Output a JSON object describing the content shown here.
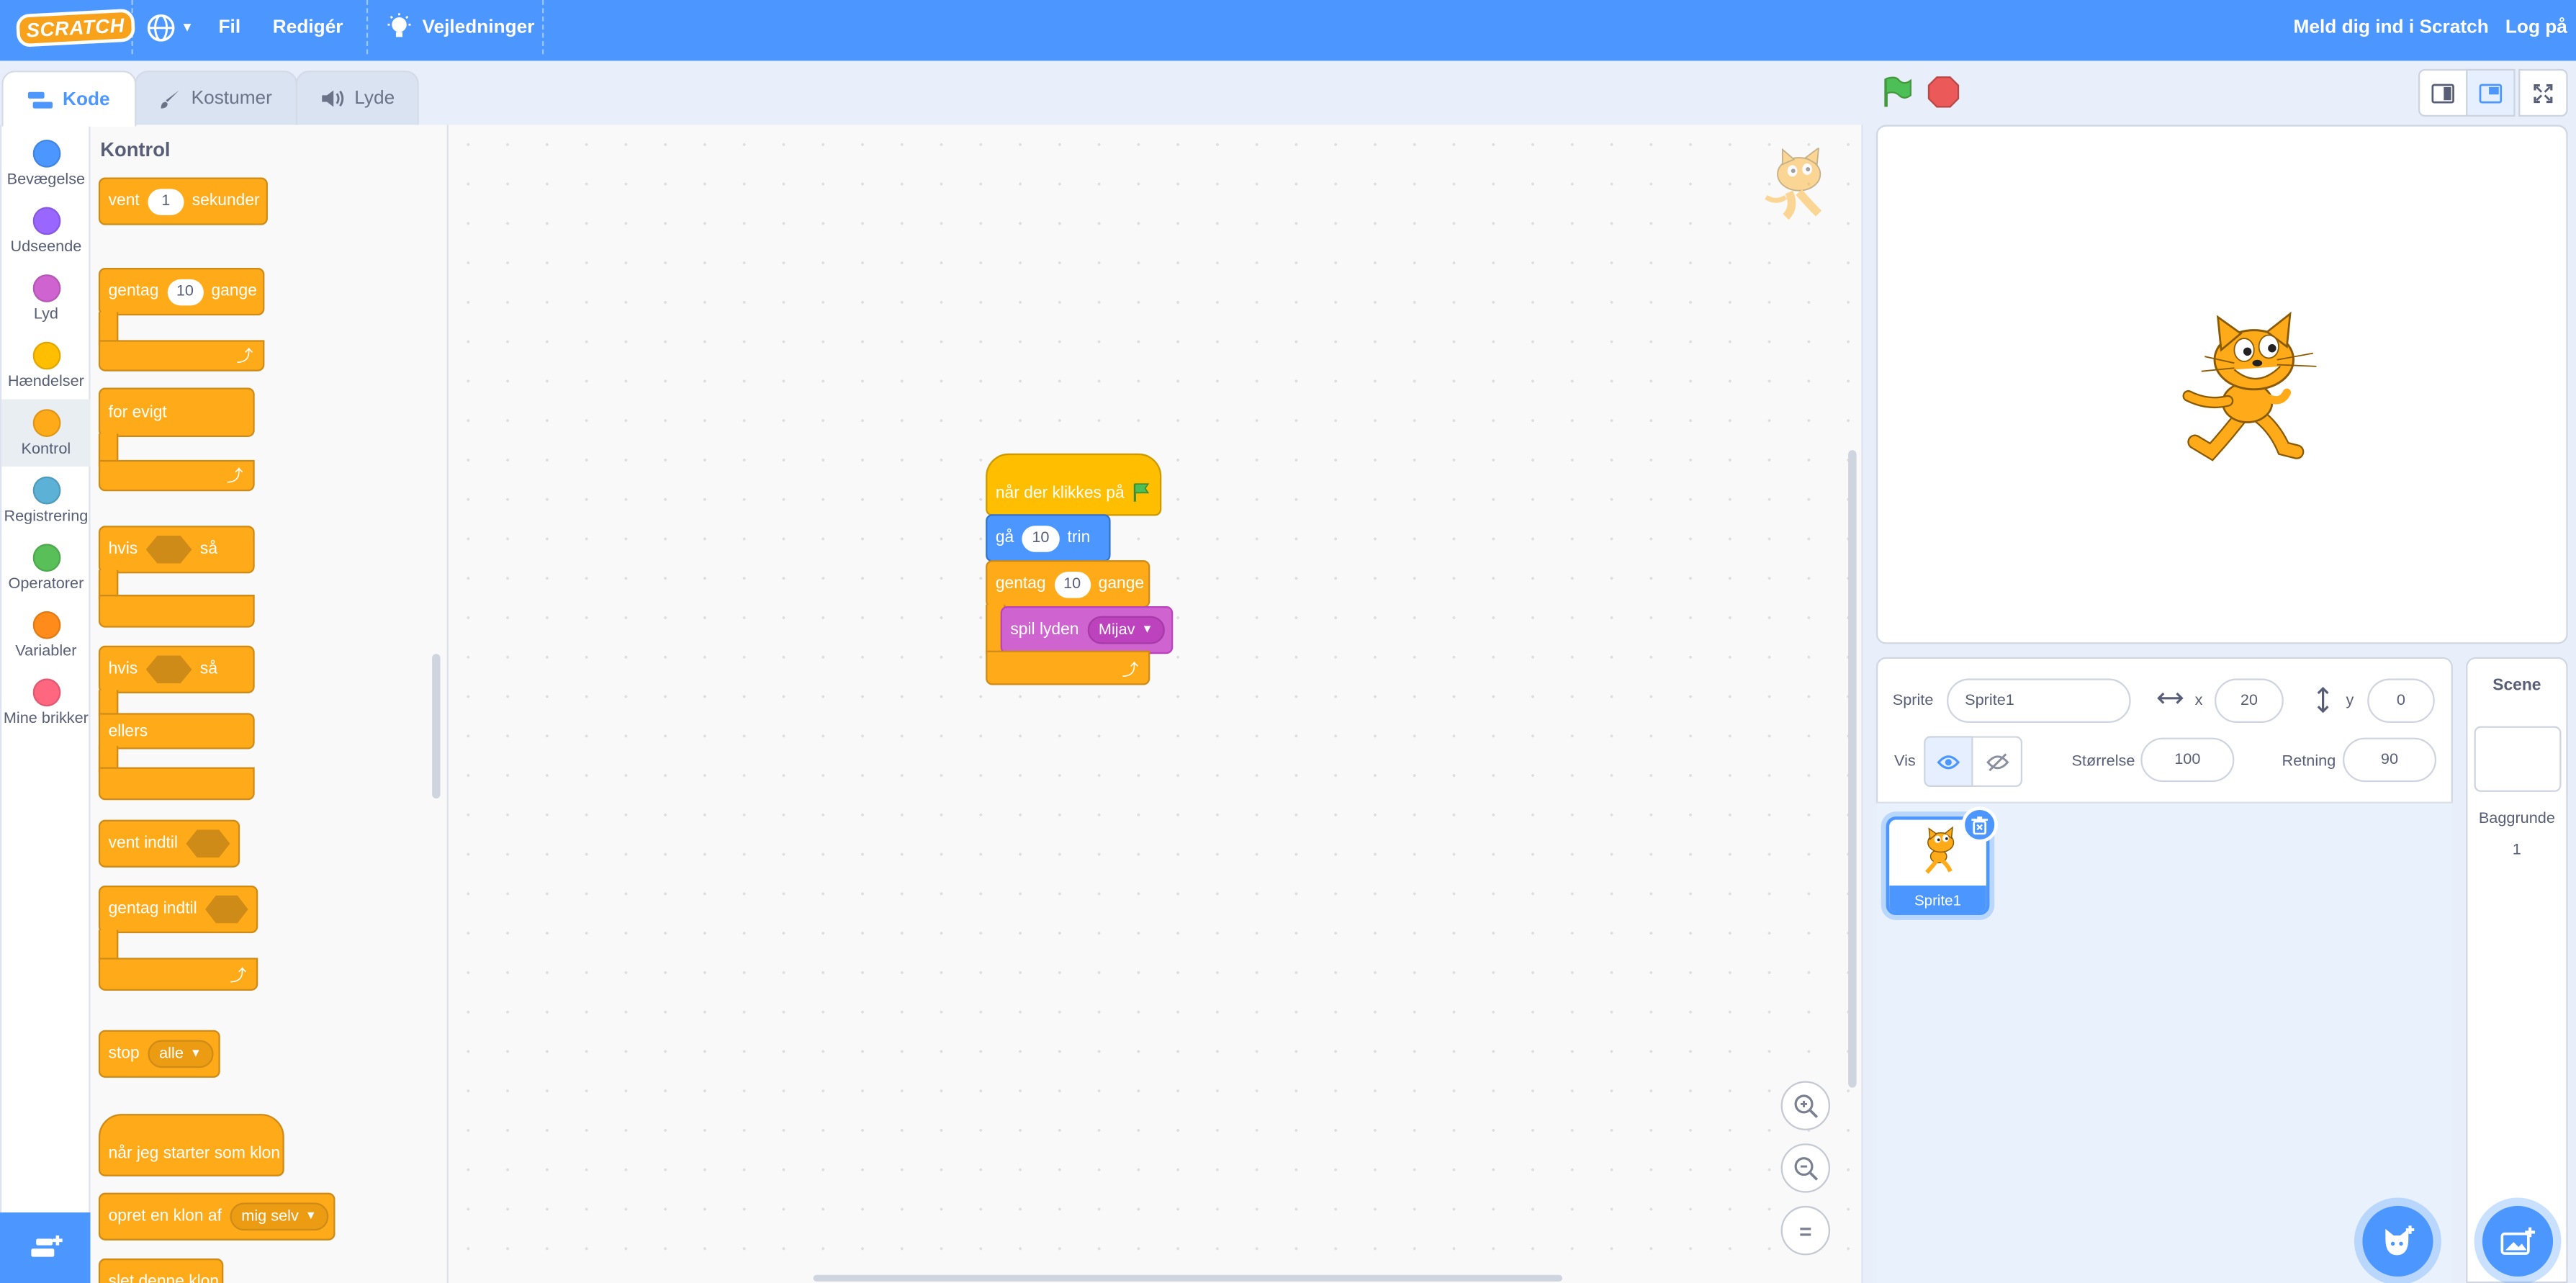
{
  "menubar": {
    "logo": "SCRATCH",
    "file": "Fil",
    "edit": "Redigér",
    "tutorials": "Vejledninger",
    "join": "Meld dig ind i Scratch",
    "signin": "Log på"
  },
  "tabs": {
    "code": "Kode",
    "costumes": "Kostumer",
    "sounds": "Lyde"
  },
  "categories": [
    {
      "label": "Bevægelse",
      "color": "#4c97ff"
    },
    {
      "label": "Udseende",
      "color": "#9966ff"
    },
    {
      "label": "Lyd",
      "color": "#cf63cf"
    },
    {
      "label": "Hændelser",
      "color": "#ffbf00"
    },
    {
      "label": "Kontrol",
      "color": "#ffab19"
    },
    {
      "label": "Registrering",
      "color": "#5cb1d6"
    },
    {
      "label": "Operatorer",
      "color": "#59c059"
    },
    {
      "label": "Variabler",
      "color": "#ff8c1a"
    },
    {
      "label": "Mine brikker",
      "color": "#ff6680"
    }
  ],
  "palette": {
    "title": "Kontrol",
    "wait": {
      "a": "vent",
      "v": "1",
      "b": "sekunder"
    },
    "repeat": {
      "a": "gentag",
      "v": "10",
      "b": "gange"
    },
    "forever": "for evigt",
    "if_then": {
      "a": "hvis",
      "b": "så"
    },
    "if_else": {
      "a": "hvis",
      "b": "så",
      "c": "ellers"
    },
    "wait_until": "vent indtil",
    "repeat_until": "gentag indtil",
    "stop": {
      "a": "stop",
      "v": "alle"
    },
    "clone_start": "når jeg starter som klon",
    "create_clone": {
      "a": "opret en klon af",
      "v": "mig selv"
    },
    "delete_clone": "slet denne klon"
  },
  "script": {
    "hat": "når der klikkes på",
    "move": {
      "a": "gå",
      "v": "10",
      "b": "trin"
    },
    "repeat": {
      "a": "gentag",
      "v": "10",
      "b": "gange"
    },
    "play": {
      "a": "spil lyden",
      "v": "Mijav"
    }
  },
  "sprite": {
    "label": "Sprite",
    "name": "Sprite1",
    "x_label": "x",
    "x": "20",
    "y_label": "y",
    "y": "0",
    "show_label": "Vis",
    "size_label": "Størrelse",
    "size": "100",
    "direction_label": "Retning",
    "direction": "90",
    "thumb_name": "Sprite1"
  },
  "scene": {
    "title": "Scene",
    "backdrops_label": "Baggrunde",
    "backdrops_count": "1"
  }
}
